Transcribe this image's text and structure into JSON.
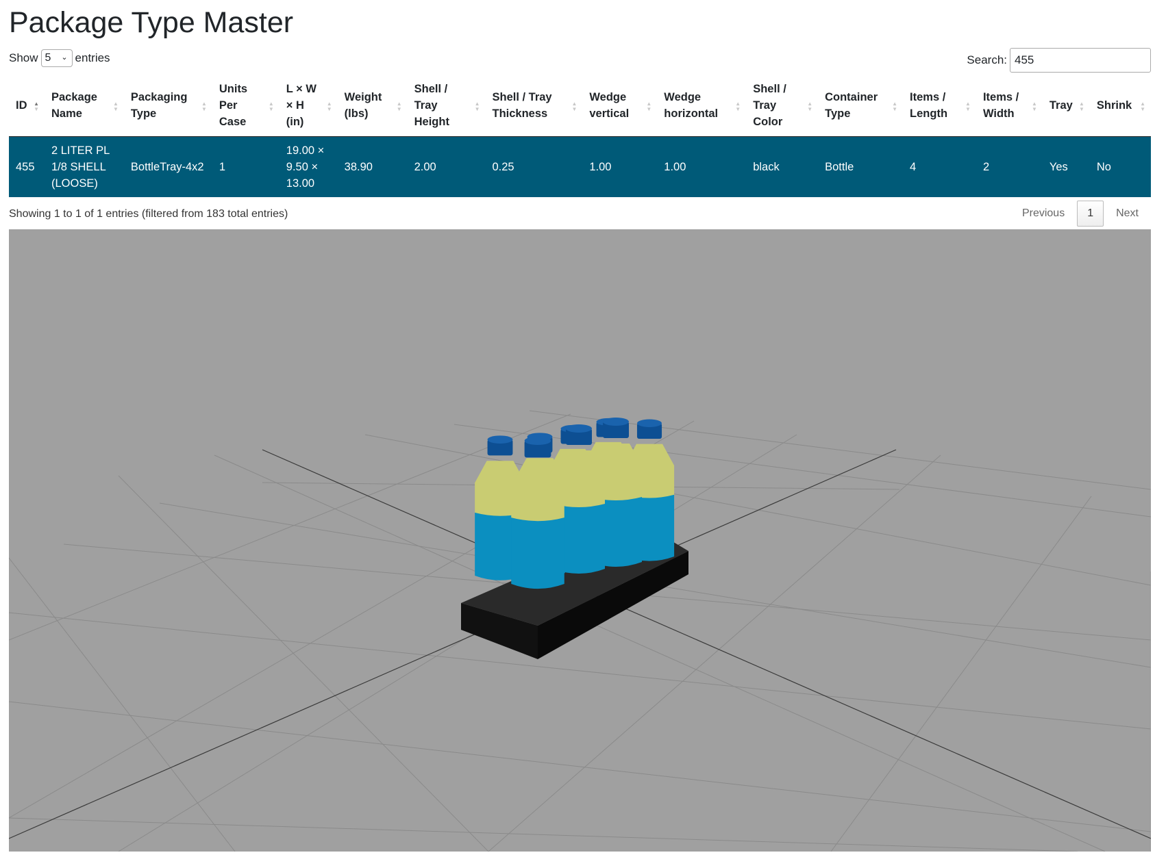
{
  "page": {
    "title": "Package Type Master"
  },
  "length_control": {
    "show_label": "Show",
    "value": "5",
    "entries_label": "entries"
  },
  "search": {
    "label": "Search:",
    "value": "455"
  },
  "table": {
    "columns": [
      [
        "ID"
      ],
      [
        "Package",
        "Name"
      ],
      [
        "Packaging",
        "Type"
      ],
      [
        "Units",
        "Per",
        "Case"
      ],
      [
        "L × W",
        "× H",
        "(in)"
      ],
      [
        "Weight",
        "(lbs)"
      ],
      [
        "Shell /",
        "Tray",
        "Height"
      ],
      [
        "Shell / Tray",
        "Thickness"
      ],
      [
        "Wedge",
        "vertical"
      ],
      [
        "Wedge",
        "horizontal"
      ],
      [
        "Shell /",
        "Tray",
        "Color"
      ],
      [
        "Container",
        "Type"
      ],
      [
        "Items /",
        "Length"
      ],
      [
        "Items /",
        "Width"
      ],
      [
        "Tray"
      ],
      [
        "Shrink"
      ]
    ],
    "rows": [
      [
        [
          "455"
        ],
        [
          "2 LITER PL",
          "1/8 SHELL",
          "(LOOSE)"
        ],
        [
          "BottleTray-4x2"
        ],
        [
          "1"
        ],
        [
          "19.00 ×",
          "9.50 ×",
          "13.00"
        ],
        [
          "38.90"
        ],
        [
          "2.00"
        ],
        [
          "0.25"
        ],
        [
          "1.00"
        ],
        [
          "1.00"
        ],
        [
          "black"
        ],
        [
          "Bottle"
        ],
        [
          "4"
        ],
        [
          "2"
        ],
        [
          "Yes"
        ],
        [
          "No"
        ]
      ]
    ]
  },
  "info": "Showing 1 to 1 of 1 entries (filtered from 183 total entries)",
  "pagination": {
    "previous": "Previous",
    "current": "1",
    "next": "Next"
  },
  "viewer": {
    "background": "#a0a0a0",
    "grid_color": "#8a8a8a",
    "axis_color": "#3a3a3a",
    "tray_color": "#111111",
    "bottle_body_color": "#0b8fc0",
    "bottle_top_color": "#c9cc72",
    "cap_color": "#0d4f93"
  }
}
